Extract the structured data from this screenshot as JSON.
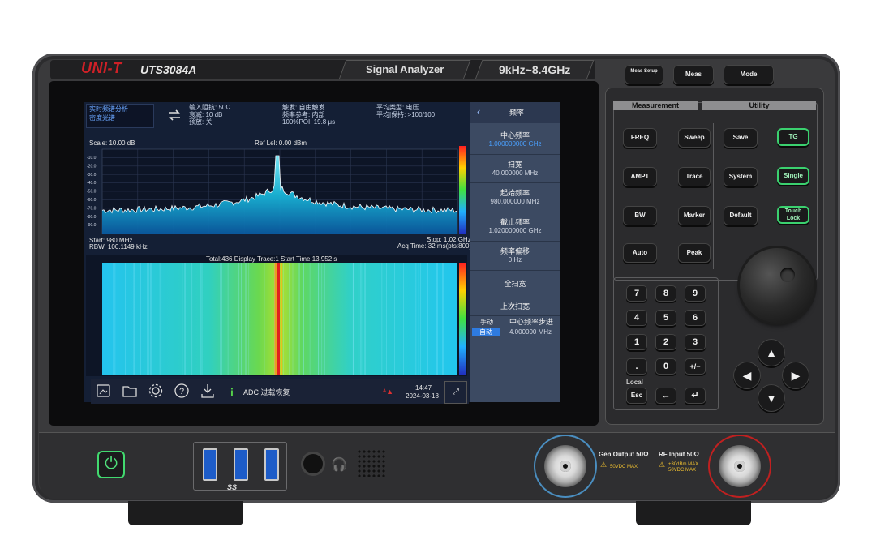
{
  "device": {
    "brand": "UNI-T",
    "model": "UTS3084A",
    "product_name": "Signal Analyzer",
    "freq_range": "9kHz~8.4GHz"
  },
  "screen": {
    "mode_line1": "实时频谱分析",
    "mode_line2": "密度光谱",
    "params_col1": [
      "输入阻抗: 50Ω",
      "衰减: 10 dB",
      "预放: 关"
    ],
    "params_col2": [
      "触发: 自由触发",
      "频率参考: 内部",
      "100%POI: 19.8 μs"
    ],
    "params_col3": [
      "平均类型: 电压",
      "平均|保持: >100/100"
    ],
    "scale": "Scale: 10.00 dB",
    "ref_level": "Ref Lel: 0.00 dBm",
    "y_ticks": [
      "-10.0",
      "-20.0",
      "-30.0",
      "-40.0",
      "-50.0",
      "-60.0",
      "-70.0",
      "-80.0",
      "-90.0"
    ],
    "start_freq": "Start: 980 MHz",
    "stop_freq": "Stop: 1.02 GHz",
    "rbw": "RBW: 100.1149 kHz",
    "acq_time": "Acq Time: 32 ms(pts:800)",
    "waterfall_info": "Total:436   Display Trace:1    Start Time:13.952 s",
    "status_message": "ADC 过载恢复",
    "time": "14:47",
    "date": "2024-03-18"
  },
  "menu": {
    "title": "频率",
    "items": [
      {
        "label": "中心频率",
        "value": "1.000000000 GHz"
      },
      {
        "label": "扫宽",
        "value": "40.000000 MHz"
      },
      {
        "label": "起始频率",
        "value": "980.000000 MHz"
      },
      {
        "label": "截止频率",
        "value": "1.020000000 GHz"
      },
      {
        "label": "频率偏移",
        "value": "0 Hz"
      },
      {
        "label": "全扫宽",
        "value": ""
      },
      {
        "label": "上次扫宽",
        "value": ""
      }
    ],
    "step_manual": "手动",
    "step_auto": "自动",
    "step_label": "中心频率步进",
    "step_value": "4.000000 MHz"
  },
  "panel": {
    "top_buttons": [
      "Meas Setup",
      "Meas",
      "Mode"
    ],
    "measurement_title": "Measurement",
    "utility_title": "Utility",
    "col1": [
      "FREQ",
      "AMPT",
      "BW",
      "Auto"
    ],
    "col2": [
      "Sweep",
      "Trace",
      "Marker",
      "Peak"
    ],
    "col3": [
      "Save",
      "System",
      "Default"
    ],
    "col4": [
      "TG",
      "Single",
      "Touch Lock"
    ],
    "keypad": [
      "7",
      "8",
      "9",
      "4",
      "5",
      "6",
      "1",
      "2",
      "3",
      ".",
      "0",
      "+/−"
    ],
    "local_label": "Local",
    "esc": "Esc"
  },
  "front": {
    "usb_label": "SS",
    "gen_output": "Gen Output 50Ω",
    "gen_warn": "50VDC MAX",
    "rf_input": "RF Input  50Ω",
    "rf_warn1": "+30dBm MAX",
    "rf_warn2": "50VDC MAX"
  },
  "colors": {
    "accent_green": "#3bd16f",
    "brand_red": "#cf2027",
    "screen_bg": "#141f35",
    "menu_bg": "#3c4a62",
    "spectrum_cyan": "#20c8ea"
  }
}
